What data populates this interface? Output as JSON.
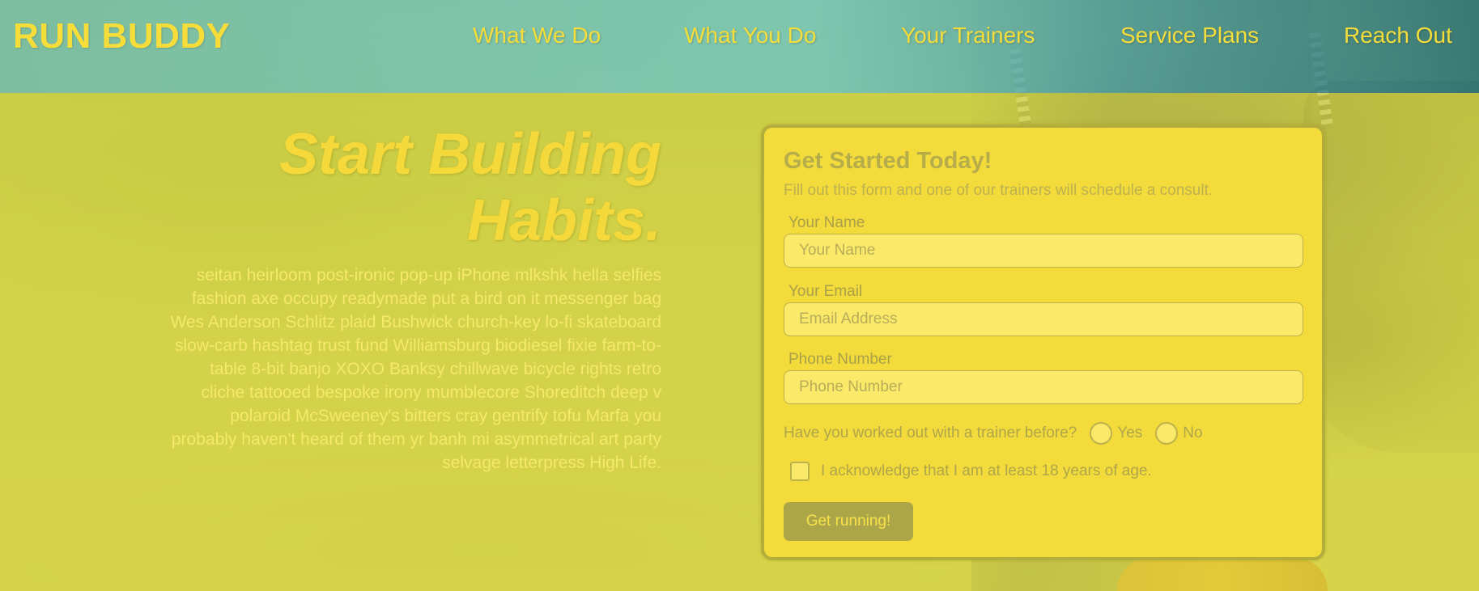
{
  "header": {
    "logo": "RUN BUDDY",
    "nav": [
      {
        "label": "What We Do"
      },
      {
        "label": "What You Do"
      },
      {
        "label": "Your Trainers"
      },
      {
        "label": "Service Plans"
      },
      {
        "label": "Reach Out"
      }
    ]
  },
  "hero": {
    "title_line1": "Start Building",
    "title_line2": "Habits.",
    "body": "seitan heirloom post-ironic pop-up iPhone mlkshk hella selfies fashion axe occupy readymade put a bird on it messenger bag Wes Anderson Schlitz plaid Bushwick church-key lo-fi skateboard slow-carb hashtag trust fund Williamsburg biodiesel fixie farm-to-table 8-bit banjo XOXO Banksy chillwave bicycle rights retro cliche tattooed bespoke irony mumblecore Shoreditch deep v polaroid McSweeney's bitters cray gentrify tofu Marfa you probably haven't heard of them yr banh mi asymmetrical art party selvage letterpress High Life."
  },
  "form": {
    "title": "Get Started Today!",
    "subtitle": "Fill out this form and one of our trainers will schedule a consult.",
    "name": {
      "label": "Your Name",
      "placeholder": "Your Name",
      "value": ""
    },
    "email": {
      "label": "Your Email",
      "placeholder": "Email Address",
      "value": ""
    },
    "phone": {
      "label": "Phone Number",
      "placeholder": "Phone Number",
      "value": ""
    },
    "trainer_question": "Have you worked out with a trainer before?",
    "trainer_options": [
      "Yes",
      "No"
    ],
    "trainer_selected": null,
    "age_ack_label": "I acknowledge that I am at least 18 years of age.",
    "age_ack_checked": false,
    "submit_label": "Get running!"
  },
  "colors": {
    "brand_yellow": "#f6dd3a",
    "header_teal": "#78bea9",
    "card_bg": "#f2db3a",
    "button_bg": "#aca648"
  }
}
